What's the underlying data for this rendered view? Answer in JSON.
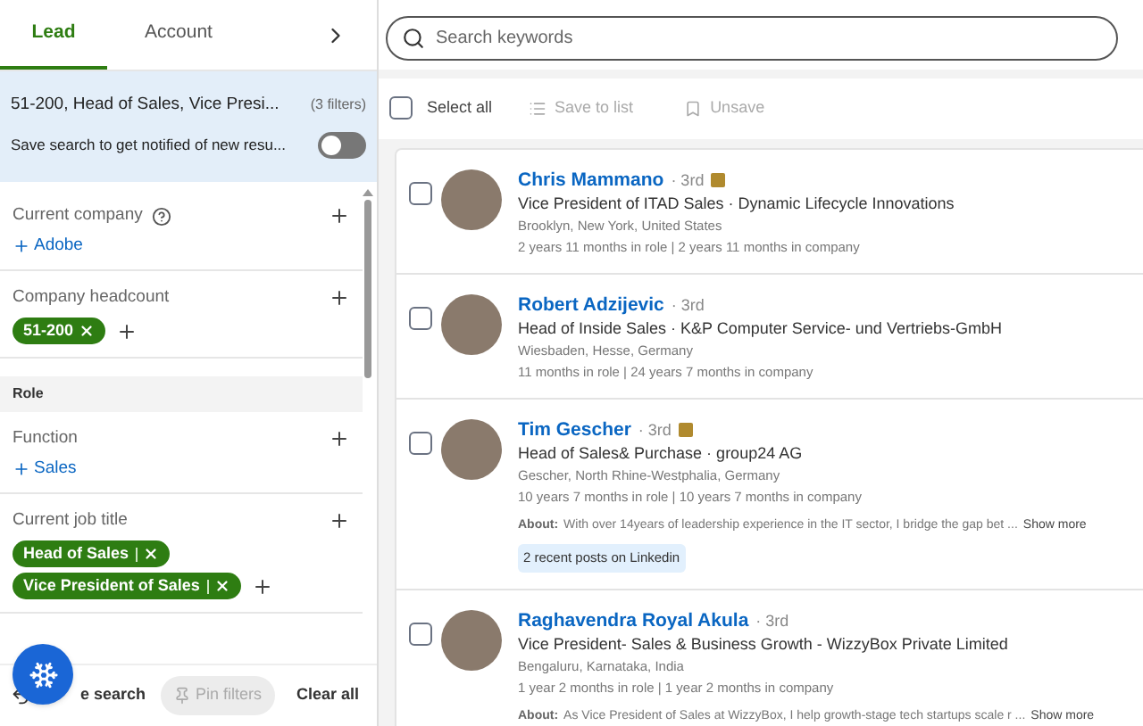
{
  "tabs": [
    {
      "label": "Lead",
      "selected": true
    },
    {
      "label": "Account",
      "selected": false
    }
  ],
  "summary": {
    "text": "51-200, Head of Sales, Vice Presi...",
    "count": "(3 filters)",
    "save_label": "Save search to get notified of new resu...",
    "on": false
  },
  "filters": [
    {
      "kind": "filter",
      "label": "Current company",
      "help": true,
      "links": [
        "Adobe"
      ]
    },
    {
      "kind": "filter",
      "label": "Company headcount",
      "help": false,
      "chips": [
        "51-200"
      ],
      "add_chip": true
    },
    {
      "kind": "section",
      "label": "Role"
    },
    {
      "kind": "filter",
      "label": "Function",
      "help": false,
      "links": [
        "Sales"
      ]
    },
    {
      "kind": "filter",
      "label": "Current job title",
      "help": false,
      "chips": [
        "Head of Sales",
        "Vice President of Sales"
      ],
      "add_chip": true
    }
  ],
  "bottom": {
    "save": "e search",
    "pin": "Pin filters",
    "clear": "Clear all"
  },
  "search": {
    "placeholder": "Search keywords"
  },
  "toolbar": {
    "select_all": "Select all",
    "checked": false,
    "save": "Save to list",
    "unsave": "Unsave"
  },
  "results": [
    {
      "name": "Chris Mammano",
      "degree": "· 3rd",
      "premium": true,
      "title": "Vice President of ITAD Sales · Dynamic Lifecycle Innovations",
      "location": "Brooklyn, New York, United States",
      "tenure": "2 years 11 months in role | 2 years 11 months in company",
      "checked": false
    },
    {
      "name": "Robert Adzijevic",
      "degree": "· 3rd",
      "premium": false,
      "title": "Head of Inside Sales · K&P Computer Service- und Vertriebs-GmbH",
      "location": "Wiesbaden, Hesse, Germany",
      "tenure": "11 months in role | 24 years 7 months in company",
      "checked": false
    },
    {
      "name": "Tim Gescher",
      "degree": "· 3rd",
      "premium": true,
      "title": "Head of Sales& Purchase · group24 AG",
      "location": "Gescher, North Rhine-Westphalia, Germany",
      "tenure": "10 years 7 months in role | 10 years 7 months in company",
      "about_label": "About:",
      "about": "With over 14years of leadership experience in the IT sector, I bridge the gap bet ...",
      "show_more": "Show more",
      "posts": "2 recent posts on Linkedin",
      "checked": false
    },
    {
      "name": "Raghavendra Royal Akula",
      "degree": "· 3rd",
      "premium": false,
      "title": "Vice President- Sales & Business Growth - WizzyBox Private Limited",
      "location": "Bengaluru, Karnataka, India",
      "tenure": "1 year 2 months in role | 1 year 2 months in company",
      "about_label": "About:",
      "about": "As Vice President of Sales at WizzyBox, I help growth-stage tech startups scale r ...",
      "show_more": "Show more",
      "checked": false
    }
  ]
}
